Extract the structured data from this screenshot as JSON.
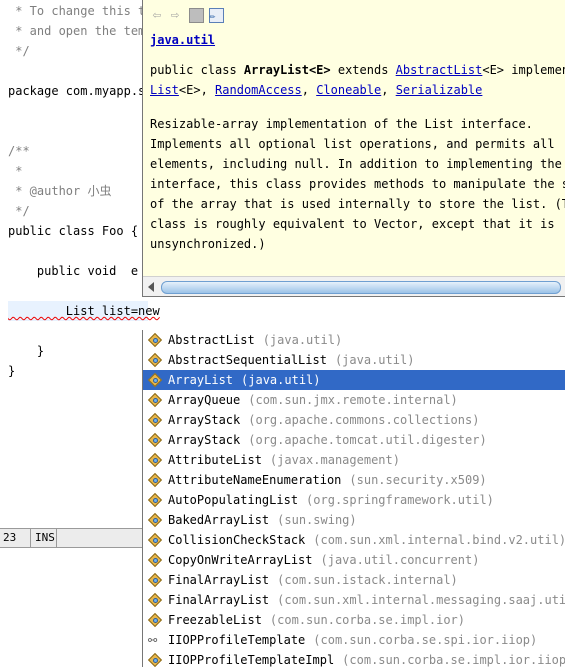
{
  "editor": {
    "lines": [
      {
        "text": " * To change this t",
        "cls": "comment"
      },
      {
        "text": " * and open the tem",
        "cls": "comment"
      },
      {
        "text": " */",
        "cls": "comment"
      },
      {
        "text": "package com.myapp.s"
      },
      {
        "text": "/**",
        "cls": "comment"
      },
      {
        "text": " *",
        "cls": "comment"
      },
      {
        "text": " * @author 小虫",
        "cls": "comment"
      },
      {
        "text": " */",
        "cls": "comment"
      },
      {
        "text": "public class Foo {"
      },
      {
        "text": "    public void  e"
      },
      {
        "text": "        List list=new"
      },
      {
        "text": "    }"
      },
      {
        "text": "}"
      }
    ]
  },
  "status": {
    "line": "23",
    "mode": "INS"
  },
  "javadoc": {
    "package_link": "java.util",
    "decl_prefix": "public class ",
    "class_name": "ArrayList<E>",
    "extends_kw": " extends ",
    "superclass": "AbstractList",
    "superclass_generic": "<E>",
    "implements_kw": " implemen",
    "interfaces": [
      "List",
      "RandomAccess",
      "Cloneable",
      "Serializable"
    ],
    "list_generic": "<E>",
    "description_lines": [
      "Resizable-array implementation of the List interface.",
      "Implements all optional list operations, and permits all",
      "elements, including null. In addition to implementing the Li",
      "interface, this class provides methods to manipulate the siz",
      "of the array that is used internally to store the list. (Thi",
      "class is roughly equivalent to Vector, except that it is",
      "unsynchronized.)"
    ]
  },
  "proposals": [
    {
      "name": "AbstractList",
      "pkg": "(java.util)",
      "icon": "class-icon"
    },
    {
      "name": "AbstractSequentialList",
      "pkg": "(java.util)",
      "icon": "class-icon"
    },
    {
      "name": "ArrayList",
      "pkg": "(java.util)",
      "icon": "class-icon",
      "selected": true
    },
    {
      "name": "ArrayQueue",
      "pkg": "(com.sun.jmx.remote.internal)",
      "icon": "class-icon"
    },
    {
      "name": "ArrayStack",
      "pkg": "(org.apache.commons.collections)",
      "icon": "class-icon"
    },
    {
      "name": "ArrayStack",
      "pkg": "(org.apache.tomcat.util.digester)",
      "icon": "class-icon"
    },
    {
      "name": "AttributeList",
      "pkg": "(javax.management)",
      "icon": "class-icon"
    },
    {
      "name": "AttributeNameEnumeration",
      "pkg": "(sun.security.x509)",
      "icon": "class-icon"
    },
    {
      "name": "AutoPopulatingList",
      "pkg": "(org.springframework.util)",
      "icon": "class-icon"
    },
    {
      "name": "BakedArrayList",
      "pkg": "(sun.swing)",
      "icon": "class-icon"
    },
    {
      "name": "CollisionCheckStack",
      "pkg": "(com.sun.xml.internal.bind.v2.util)",
      "icon": "class-icon"
    },
    {
      "name": "CopyOnWriteArrayList",
      "pkg": "(java.util.concurrent)",
      "icon": "class-icon"
    },
    {
      "name": "FinalArrayList",
      "pkg": "(com.sun.istack.internal)",
      "icon": "class-icon"
    },
    {
      "name": "FinalArrayList",
      "pkg": "(com.sun.xml.internal.messaging.saaj.util)",
      "icon": "class-icon"
    },
    {
      "name": "FreezableList",
      "pkg": "(com.sun.corba.se.impl.ior)",
      "icon": "class-icon"
    },
    {
      "name": "IIOPProfileTemplate",
      "pkg": "(com.sun.corba.se.spi.ior.iiop)",
      "icon": "interface-icon"
    },
    {
      "name": "IIOPProfileTemplateImpl",
      "pkg": "(com.sun.corba.se.impl.ior.iiop)",
      "icon": "class-icon"
    }
  ]
}
